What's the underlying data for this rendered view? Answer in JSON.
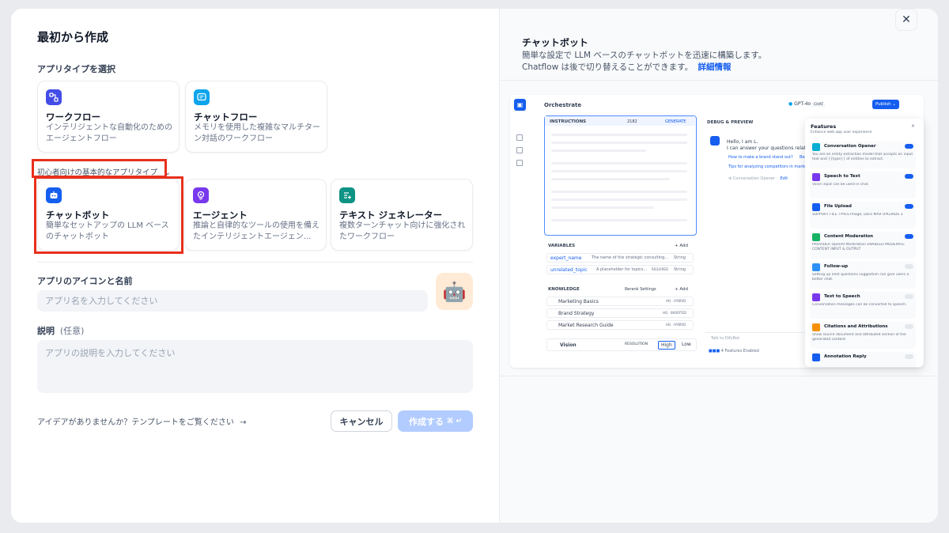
{
  "dialog": {
    "title": "最初から作成",
    "close_icon": "close-icon"
  },
  "app_type": {
    "section_label": "アプリタイプを選択",
    "top_cards": [
      {
        "title": "ワークフロー",
        "desc": "インテリジェントな自動化のためのエージェントフロー",
        "icon": "workflow-icon",
        "color": "#444ce7"
      },
      {
        "title": "チャットフロー",
        "desc": "メモリを使用した複雑なマルチターン対話のワークフロー",
        "icon": "chatflow-icon",
        "color": "#0ba5ec"
      }
    ],
    "basic_label": "初心者向けの基本的なアプリタイプ",
    "basic_cards": [
      {
        "title": "チャットボット",
        "desc": "簡単なセットアップの LLM ベースのチャットボット",
        "icon": "chatbot-icon",
        "color": "#155eef"
      },
      {
        "title": "エージェント",
        "desc": "推論と自律的なツールの使用を備えたインテリジェントエージェン...",
        "icon": "agent-icon",
        "color": "#7839ee"
      },
      {
        "title": "テキスト ジェネレーター",
        "desc": "複数ターンチャット向けに強化されたワークフロー",
        "icon": "text-generator-icon",
        "color": "#0e9384"
      }
    ]
  },
  "name_section": {
    "label": "アプリのアイコンと名前",
    "placeholder": "アプリ名を入力してください",
    "avatar": "🤖"
  },
  "description_section": {
    "label": "説明",
    "optional": "(任意)",
    "placeholder": "アプリの説明を入力してください"
  },
  "footer": {
    "template_link": "アイデアがありませんか？テンプレートをご覧ください",
    "arrow": "→",
    "cancel": "キャンセル",
    "create": "作成する",
    "create_shortcut": "⌘ ↵"
  },
  "preview": {
    "title": "チャットボット",
    "desc_line1": "簡単な設定で LLM ベースのチャットボットを迅速に構築します。",
    "desc_line2": "Chatflow は後で切り替えることができます。",
    "learn_more": "詳細情報",
    "screenshot": {
      "orchestrate": "Orchestrate",
      "model": "GPT-4o",
      "chat_badge": "CHAT",
      "publish": "Publish",
      "instructions": "INSTRUCTIONS",
      "instr_count": "2182",
      "generate": "GENERATE",
      "debug": "DEBUG & PREVIEW",
      "hello1": "Hello, I am L.",
      "hello2": "I can answer your questions related",
      "q1": "How to make a brand stand out?",
      "q1b": "Bes",
      "q2": "Tips for analyzing competitors in market",
      "opener": "Conversation Opener",
      "edit": "Edit",
      "variables": "VARIABLES",
      "add": "Add",
      "var1": "expert_name",
      "var1_desc": "The name of the strategic consulting...",
      "var1_type": "String",
      "var2": "unrelated_topic",
      "var2_desc": "A placeholder for topics...",
      "var2_req": "REQUIRED",
      "var2_type": "String",
      "knowledge": "KNOWLEDGE",
      "rerank": "Rerank Settings",
      "kb1": "Marketing Basics",
      "kb1_tag": "HQ · HYBRID",
      "kb2": "Brand Strategy",
      "kb2_tag": "HQ · INVERTED",
      "kb3": "Market Research Guide",
      "kb3_tag": "HQ · HYBRID",
      "vision": "Vision",
      "resolution": "RESOLUTION",
      "high": "High",
      "low": "Low",
      "talk": "Talk to DifyBot",
      "features_enabled": "4 Features Enabled"
    },
    "features": {
      "title": "Features",
      "subtitle": "Enhance web app user experience",
      "items": [
        {
          "title": "Conversation Opener",
          "desc": "You are an entity extraction model that accepts an input text and {{type}} of entities to extract.",
          "on": true,
          "color": "#06aed4"
        },
        {
          "title": "Speech to Text",
          "desc": "Voice input can be used in chat.",
          "on": true,
          "color": "#7839ee"
        },
        {
          "title": "File Upload",
          "desc": "SUPPORT FILE TYPES  Image, Docs   MAX UPLOADS 3",
          "on": true,
          "color": "#155eef"
        },
        {
          "title": "Content Moderation",
          "desc": "PROVIDER OpenAI Moderation   ENABLED MODERATE CONTENT INPUT & OUTPUT",
          "on": true,
          "color": "#16b364"
        },
        {
          "title": "Follow-up",
          "desc": "Setting up next questions suggestion can give users a better chat.",
          "on": false,
          "color": "#2e90fa"
        },
        {
          "title": "Text to Speech",
          "desc": "Conversation messages can be converted to speech.",
          "on": false,
          "color": "#7839ee"
        },
        {
          "title": "Citations and Attributions",
          "desc": "Show source document and attributed section of the generated content.",
          "on": false,
          "color": "#f79009"
        },
        {
          "title": "Annotation Reply",
          "desc": "",
          "on": false,
          "color": "#155eef"
        }
      ]
    }
  }
}
